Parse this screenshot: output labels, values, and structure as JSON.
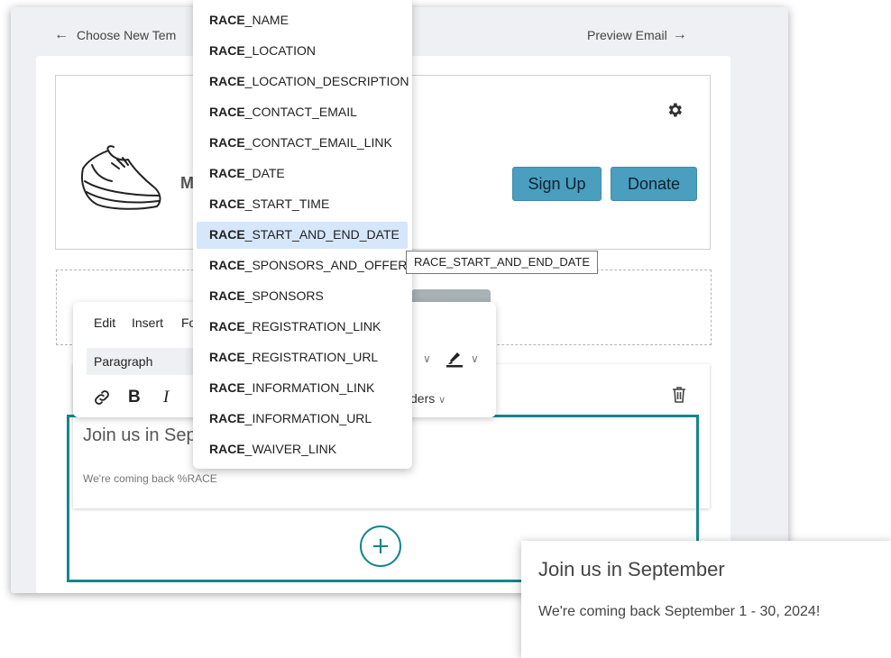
{
  "nav": {
    "back_label": "Choose New Tem",
    "back_icon": "arrow-left-icon",
    "preview_label": "Preview Email",
    "preview_icon": "arrow-right-icon"
  },
  "header_block": {
    "logo_icon": "running-shoe-icon",
    "brand_initial": "M",
    "settings_icon": "gear-icon",
    "signup_label": "Sign Up",
    "donate_label": "Donate",
    "button_color": "#4a9fc0"
  },
  "toolbar": {
    "menu": {
      "edit": "Edit",
      "insert": "Insert",
      "format": "Fo"
    },
    "block_format": "Paragraph",
    "bold": "B",
    "italic": "I",
    "borders_menu": "ders",
    "link_icon": "link-icon",
    "highlight_icon": "highlight-icon"
  },
  "text_block": {
    "title": "Join us in Sep",
    "body": "We're coming back %RACE",
    "accent_color": "#14868c",
    "add_icon": "plus-circle-icon",
    "delete_icon": "trash-icon"
  },
  "dropdown": {
    "match": "RACE",
    "items": [
      {
        "rest": "_NAME"
      },
      {
        "rest": "_LOCATION"
      },
      {
        "rest": "_LOCATION_DESCRIPTION"
      },
      {
        "rest": "_CONTACT_EMAIL"
      },
      {
        "rest": "_CONTACT_EMAIL_LINK"
      },
      {
        "rest": "_DATE"
      },
      {
        "rest": "_START_TIME"
      },
      {
        "rest": "_START_AND_END_DATE",
        "active": true
      },
      {
        "rest": "_SPONSORS_AND_OFFERS"
      },
      {
        "rest": "_SPONSORS"
      },
      {
        "rest": "_REGISTRATION_LINK"
      },
      {
        "rest": "_REGISTRATION_URL"
      },
      {
        "rest": "_INFORMATION_LINK"
      },
      {
        "rest": "_INFORMATION_URL"
      },
      {
        "rest": "_WAIVER_LINK"
      }
    ]
  },
  "tooltip": "RACE_START_AND_END_DATE",
  "preview": {
    "title": "Join us in September",
    "body": "We're coming back September 1 - 30, 2024!"
  }
}
